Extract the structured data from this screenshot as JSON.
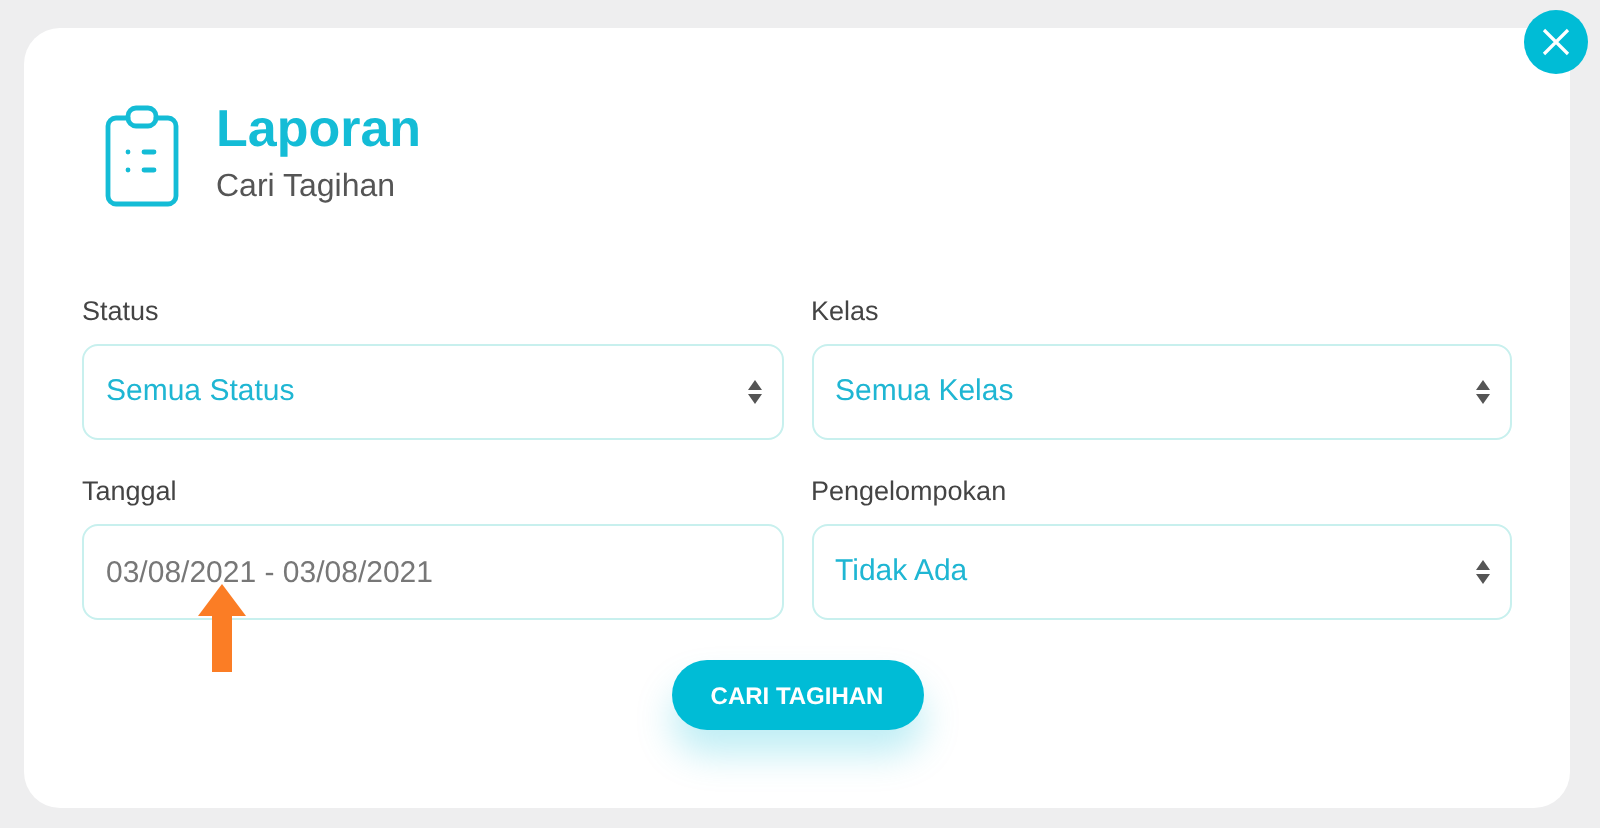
{
  "dialog": {
    "title": "Laporan",
    "subtitle": "Cari Tagihan"
  },
  "fields": [
    {
      "label": "Status",
      "kind": "select",
      "value": "Semua Status"
    },
    {
      "label": "Kelas",
      "kind": "select",
      "value": "Semua Kelas"
    },
    {
      "label": "Tanggal",
      "kind": "date",
      "value": "03/08/2021 - 03/08/2021"
    },
    {
      "label": "Pengelompokan",
      "kind": "select",
      "value": "Tidak Ada"
    }
  ],
  "submit_button": "CARI TAGIHAN"
}
